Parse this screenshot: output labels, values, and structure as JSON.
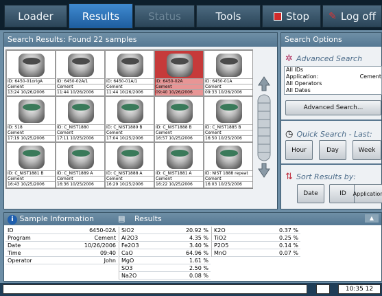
{
  "nav": {
    "loader": "Loader",
    "results": "Results",
    "status": "Status",
    "tools": "Tools",
    "stop": "Stop",
    "logoff": "Log off"
  },
  "search_results": {
    "header": "Search Results: Found 22 samples"
  },
  "samples": [
    {
      "id": "ID: 6450-01origA",
      "app": "Cement",
      "time": "13:24 10/26/2006"
    },
    {
      "id": "ID: 6450-02A/1",
      "app": "Cement",
      "time": "11:44 10/26/2006"
    },
    {
      "id": "ID: 6450-01A/1",
      "app": "Cement",
      "time": "11:44 10/26/2006"
    },
    {
      "id": "ID: 6450-02A",
      "app": "Cement",
      "time": "09:40 10/26/2006",
      "selected": true
    },
    {
      "id": "ID: 6450-01A",
      "app": "Cement",
      "time": "09:33 10/26/2006"
    },
    {
      "id": "ID: S18",
      "app": "Cement",
      "time": "17:19 10/25/2006"
    },
    {
      "id": "ID: C_NIST1880",
      "app": "Cement",
      "time": "17:11 10/25/2006"
    },
    {
      "id": "ID: C_NIST1889 B",
      "app": "Cement",
      "time": "17:04 10/25/2006"
    },
    {
      "id": "ID: C_NIST1888 B",
      "app": "Cement",
      "time": "16:57 10/25/2006"
    },
    {
      "id": "ID: C_NIST1885 B",
      "app": "Cement",
      "time": "16:50 10/25/2006"
    },
    {
      "id": "ID: C_NIST1881 B",
      "app": "Cement",
      "time": "16:43 10/25/2006"
    },
    {
      "id": "ID: C_NIST1889 A",
      "app": "Cement",
      "time": "16:36 10/25/2006"
    },
    {
      "id": "ID: C_NIST1888 A",
      "app": "Cement",
      "time": "16:29 10/25/2006"
    },
    {
      "id": "ID: C_NIST1881 A",
      "app": "Cement",
      "time": "16:22 10/25/2006"
    },
    {
      "id": "ID: NIST 1888 repeat",
      "app": "Cement",
      "time": "16:03 10/25/2006"
    }
  ],
  "search_options": {
    "header": "Search Options",
    "advanced_title": "Advanced Search",
    "criteria": [
      "All IDs",
      "Application:",
      "All Operators",
      "All Dates"
    ],
    "application_value": "Cement",
    "advanced_button": "Advanced Search...",
    "quick_title": "Quick Search - Last:",
    "quick_buttons": [
      "Hour",
      "Day",
      "Week"
    ],
    "sort_title": "Sort Results by:",
    "sort_buttons": [
      "Date",
      "ID",
      "Application"
    ]
  },
  "sample_info": {
    "header": "Sample Information",
    "rows": [
      [
        "ID",
        "6450-02A"
      ],
      [
        "Program",
        "Cement"
      ],
      [
        "Date",
        "10/26/2006"
      ],
      [
        "Time",
        "09:40"
      ],
      [
        "Operator",
        "John"
      ]
    ]
  },
  "results": {
    "header": "Results",
    "col1": [
      [
        "SiO2",
        "20.92 %"
      ],
      [
        "Al2O3",
        "4.35 %"
      ],
      [
        "Fe2O3",
        "3.40 %"
      ],
      [
        "CaO",
        "64.96 %"
      ],
      [
        "MgO",
        "1.61 %"
      ],
      [
        "SO3",
        "2.50 %"
      ],
      [
        "Na2O",
        "0.08 %"
      ]
    ],
    "col2": [
      [
        "K2O",
        "0.37 %"
      ],
      [
        "TiO2",
        "0.25 %"
      ],
      [
        "P2O5",
        "0.14 %"
      ],
      [
        "MnO",
        "0.07 %"
      ]
    ]
  },
  "statusbar": {
    "clock": "10:35 12"
  }
}
